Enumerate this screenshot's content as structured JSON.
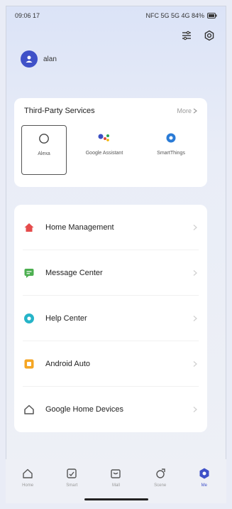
{
  "status_bar": {
    "time": "09:06 17",
    "indicators": "NFC 5G 5G 4G 84%"
  },
  "toolbar": {
    "icons": [
      "scan-icon",
      "settings-icon"
    ]
  },
  "user": {
    "name": "alan"
  },
  "services": {
    "title": "Third-Party Services",
    "more_label": "More",
    "items": [
      {
        "label": "Alexa",
        "icon": "alexa-icon",
        "selected": true
      },
      {
        "label": "Google Assistant",
        "icon": "google-assistant-icon",
        "selected": false
      },
      {
        "label": "SmartThings",
        "icon": "smartthings-icon",
        "selected": false
      }
    ]
  },
  "menu": {
    "items": [
      {
        "label": "Home Management",
        "icon": "home-icon",
        "color": "#e54b4b"
      },
      {
        "label": "Message Center",
        "icon": "message-icon",
        "color": "#4caf50"
      },
      {
        "label": "Help Center",
        "icon": "help-icon",
        "color": "#26b4c8"
      },
      {
        "label": "Android Auto",
        "icon": "android-auto-icon",
        "color": "#f5a623"
      },
      {
        "label": "Google Home Devices",
        "icon": "google-home-icon",
        "color": "#555555"
      }
    ]
  },
  "bottom_nav": {
    "items": [
      {
        "label": "Home",
        "icon": "home-nav-icon"
      },
      {
        "label": "Smart",
        "icon": "smart-nav-icon"
      },
      {
        "label": "Mall",
        "icon": "mall-nav-icon"
      },
      {
        "label": "Scene",
        "icon": "scene-nav-icon"
      },
      {
        "label": "Me",
        "icon": "me-nav-icon",
        "active": true
      }
    ]
  },
  "colors": {
    "accent": "#3f51c8",
    "background": "#e9edf7",
    "card": "#ffffff"
  }
}
